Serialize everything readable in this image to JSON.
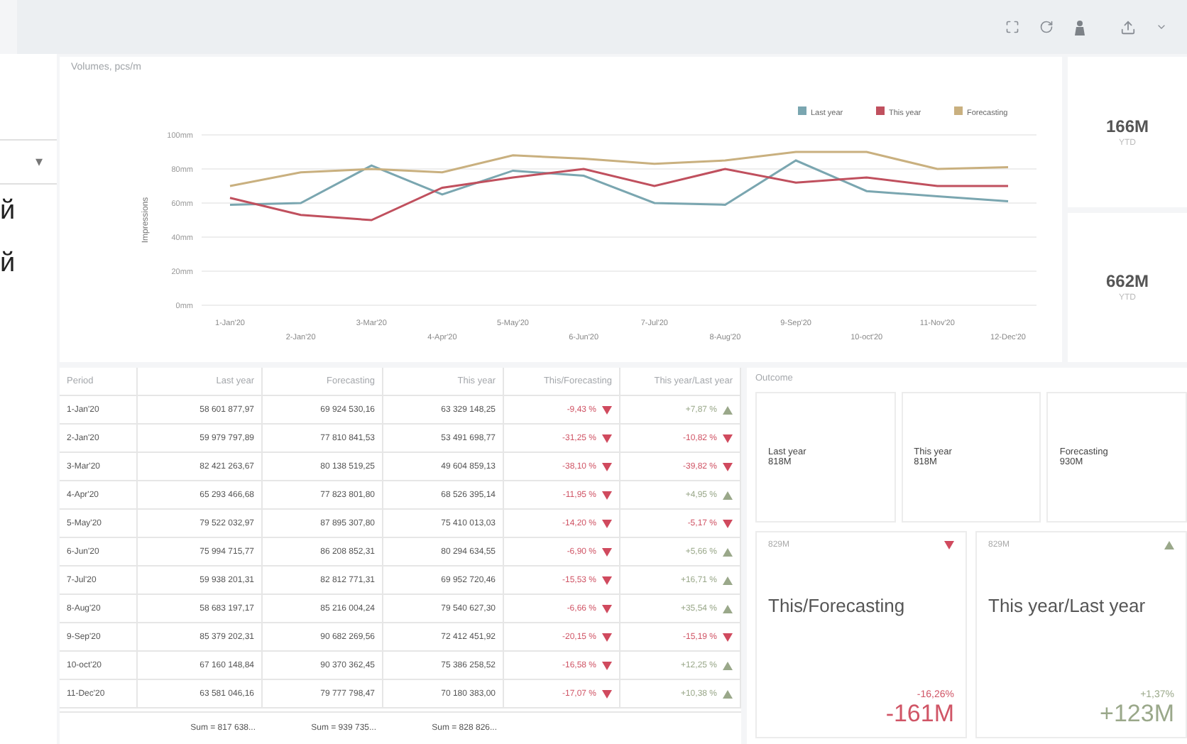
{
  "toolbar": {
    "icons": [
      {
        "kind": "fullscreen"
      },
      {
        "kind": "refresh"
      },
      {
        "kind": "figure"
      },
      {
        "kind": "upload"
      },
      {
        "kind": "caret"
      }
    ]
  },
  "sidebar": {
    "dropdown_caret": "▾",
    "fragments": [
      "й",
      "й"
    ]
  },
  "chart": {
    "title": "Volumes, pcs/m",
    "chart_data": {
      "type": "line",
      "grid": true,
      "legend": true,
      "ylabel": "Impressions",
      "categories": [
        "1-Jan'20",
        "2-Jan'20",
        "3-Mar'20",
        "4-Apr'20",
        "5-May'20",
        "6-Jun'20",
        "7-Jul'20",
        "8-Aug'20",
        "9-Sep'20",
        "10-oct'20",
        "11-Nov'20",
        "12-Dec'20"
      ],
      "ylim": [
        0,
        100
      ],
      "yticks": [
        {
          "value": 0,
          "label": "0mm"
        },
        {
          "value": 20,
          "label": "20mm"
        },
        {
          "value": 40,
          "label": "40mm"
        },
        {
          "value": 60,
          "label": "60mm"
        },
        {
          "value": 80,
          "label": "80mm"
        },
        {
          "value": 100,
          "label": "100mm"
        }
      ],
      "series": [
        {
          "name": "Last year",
          "color": "#7aa6b0",
          "values": [
            59,
            60,
            82,
            65,
            79,
            76,
            60,
            59,
            85,
            67,
            64,
            61
          ]
        },
        {
          "name": "This year",
          "color": "#c0505e",
          "values": [
            63,
            53,
            50,
            69,
            75,
            80,
            70,
            80,
            72,
            75,
            70,
            70
          ]
        },
        {
          "name": "Forecasting",
          "color": "#c9b07f",
          "values": [
            70,
            78,
            80,
            78,
            88,
            86,
            83,
            85,
            90,
            90,
            80,
            81
          ]
        }
      ]
    }
  },
  "kpis": [
    {
      "value": "166M",
      "caption": "YTD"
    },
    {
      "value": "662M",
      "caption": "YTD"
    }
  ],
  "table": {
    "columns": [
      "Period",
      "Last year",
      "Forecasting",
      "This year",
      "This/Forecasting",
      "This year/Last year"
    ],
    "rows": [
      {
        "period": "1-Jan'20",
        "last": "58 601 877,97",
        "forecast": "69 924 530,16",
        "this": "63 329 148,25",
        "vs_forecast": {
          "text": "-9,43 %",
          "rising": false
        },
        "vs_last": {
          "text": "+7,87 %",
          "rising": true
        }
      },
      {
        "period": "2-Jan'20",
        "last": "59 979 797,89",
        "forecast": "77 810 841,53",
        "this": "53 491 698,77",
        "vs_forecast": {
          "text": "-31,25 %",
          "rising": false
        },
        "vs_last": {
          "text": "-10,82 %",
          "rising": false
        }
      },
      {
        "period": "3-Mar'20",
        "last": "82 421 263,67",
        "forecast": "80 138 519,25",
        "this": "49 604 859,13",
        "vs_forecast": {
          "text": "-38,10 %",
          "rising": false
        },
        "vs_last": {
          "text": "-39,82 %",
          "rising": false
        }
      },
      {
        "period": "4-Apr'20",
        "last": "65 293 466,68",
        "forecast": "77 823 801,80",
        "this": "68 526 395,14",
        "vs_forecast": {
          "text": "-11,95 %",
          "rising": false
        },
        "vs_last": {
          "text": "+4,95 %",
          "rising": true
        }
      },
      {
        "period": "5-May'20",
        "last": "79 522 032,97",
        "forecast": "87 895 307,80",
        "this": "75 410 013,03",
        "vs_forecast": {
          "text": "-14,20 %",
          "rising": false
        },
        "vs_last": {
          "text": "-5,17 %",
          "rising": false
        }
      },
      {
        "period": "6-Jun'20",
        "last": "75 994 715,77",
        "forecast": "86 208 852,31",
        "this": "80 294 634,55",
        "vs_forecast": {
          "text": "-6,90 %",
          "rising": false
        },
        "vs_last": {
          "text": "+5,66 %",
          "rising": true
        }
      },
      {
        "period": "7-Jul'20",
        "last": "59 938 201,31",
        "forecast": "82 812 771,31",
        "this": "69 952 720,46",
        "vs_forecast": {
          "text": "-15,53 %",
          "rising": false
        },
        "vs_last": {
          "text": "+16,71 %",
          "rising": true
        }
      },
      {
        "period": "8-Aug'20",
        "last": "58 683 197,17",
        "forecast": "85 216 004,24",
        "this": "79 540 627,30",
        "vs_forecast": {
          "text": "-6,66 %",
          "rising": false
        },
        "vs_last": {
          "text": "+35,54 %",
          "rising": true
        }
      },
      {
        "period": "9-Sep'20",
        "last": "85 379 202,31",
        "forecast": "90 682 269,56",
        "this": "72 412 451,92",
        "vs_forecast": {
          "text": "-20,15 %",
          "rising": false
        },
        "vs_last": {
          "text": "-15,19 %",
          "rising": false
        }
      },
      {
        "period": "10-oct'20",
        "last": "67 160 148,84",
        "forecast": "90 370 362,45",
        "this": "75 386 258,52",
        "vs_forecast": {
          "text": "-16,58 %",
          "rising": false
        },
        "vs_last": {
          "text": "+12,25 %",
          "rising": true
        }
      },
      {
        "period": "11-Dec'20",
        "last": "63 581 046,16",
        "forecast": "79 777 798,47",
        "this": "70 180 383,00",
        "vs_forecast": {
          "text": "-17,07 %",
          "rising": false
        },
        "vs_last": {
          "text": "+10,38 %",
          "rising": true
        }
      }
    ],
    "totals": [
      "Sum = 817 638...",
      "Sum = 939 735...",
      "Sum = 828 826..."
    ]
  },
  "outcome": {
    "title": "Outcome",
    "cards": [
      {
        "label": "Last year",
        "value": "818M"
      },
      {
        "label": "This year",
        "value": "818M"
      },
      {
        "label": "Forecasting",
        "value": "930M"
      }
    ],
    "comparisons": [
      {
        "base": "829M",
        "rising": false,
        "title": "This/Forecasting",
        "percent": "-16,26%",
        "delta": "-161M"
      },
      {
        "base": "829M",
        "rising": true,
        "title": "This year/Last year",
        "percent": "+1,37%",
        "delta": "+123M"
      }
    ]
  }
}
